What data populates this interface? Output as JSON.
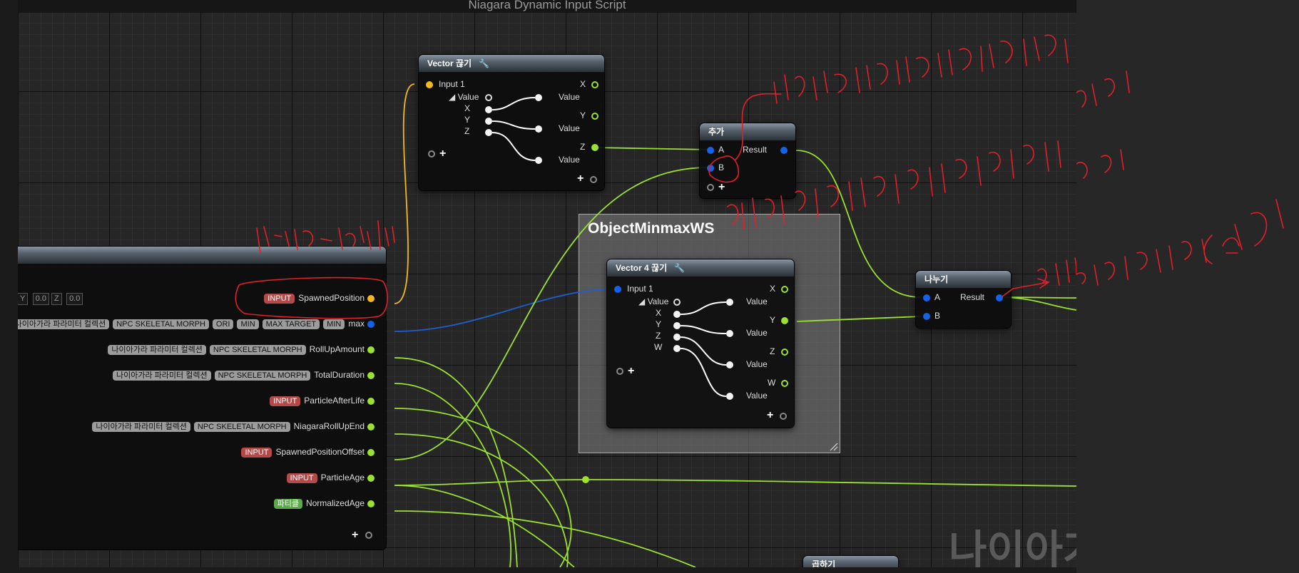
{
  "graph_title": "Niagara Dynamic Input Script",
  "watermark": "나이아가",
  "comment_title": "ObjectMinmaxWS",
  "colors": {
    "float_pin": "#9be130",
    "vector_pin": "#f2b823",
    "position_pin": "#1362e8",
    "annotation": "#e0202a"
  },
  "vec_break_node": {
    "title": "Vector 끊기",
    "input": "Input 1",
    "value": "Value",
    "subs": [
      "X",
      "Y",
      "Z"
    ],
    "outputs": [
      "X",
      "Y",
      "Z"
    ],
    "out_value": "Value"
  },
  "add_node": {
    "title": "추가",
    "a": "A",
    "b": "B",
    "result": "Result"
  },
  "vec4_break_node": {
    "title": "Vector 4 끊기",
    "input": "Input 1",
    "value": "Value",
    "subs": [
      "X",
      "Y",
      "Z",
      "W"
    ],
    "outputs": [
      "X",
      "Y",
      "Z",
      "W"
    ],
    "out_value": "Value"
  },
  "divide_node": {
    "title": "나누기",
    "a": "A",
    "b": "B",
    "result": "Result"
  },
  "multiply_node": {
    "title": "곱하기"
  },
  "map_node": {
    "vec_y_label": "Y",
    "vec_y": "0.0",
    "vec_z_label": "Z",
    "vec_z": "0.0",
    "rows": [
      {
        "tags": [
          {
            "t": "INPUT",
            "k": "input"
          }
        ],
        "name": "SpawnedPosition",
        "pin": "yellow"
      },
      {
        "tags": [
          {
            "t": "나이아가라 파라미터 컬렉션",
            "k": "gray"
          },
          {
            "t": "NPC SKELETAL MORPH",
            "k": "gray"
          },
          {
            "t": "ORI",
            "k": "gray"
          },
          {
            "t": "MIN",
            "k": "gray"
          },
          {
            "t": "MAX TARGET",
            "k": "gray"
          },
          {
            "t": "MIN",
            "k": "gray"
          }
        ],
        "name": "max",
        "pin": "blue"
      },
      {
        "tags": [
          {
            "t": "나이아가라 파라미터 컬렉션",
            "k": "gray"
          },
          {
            "t": "NPC SKELETAL MORPH",
            "k": "gray"
          }
        ],
        "name": "RollUpAmount",
        "pin": "green"
      },
      {
        "tags": [
          {
            "t": "나이아가라 파라미터 컬렉션",
            "k": "gray"
          },
          {
            "t": "NPC SKELETAL MORPH",
            "k": "gray"
          }
        ],
        "name": "TotalDuration",
        "pin": "green"
      },
      {
        "tags": [
          {
            "t": "INPUT",
            "k": "input"
          }
        ],
        "name": "ParticleAfterLife",
        "pin": "green"
      },
      {
        "tags": [
          {
            "t": "나이아가라 파라미터 컬렉션",
            "k": "gray"
          },
          {
            "t": "NPC SKELETAL MORPH",
            "k": "gray"
          }
        ],
        "name": "NiagaraRollUpEnd",
        "pin": "green"
      },
      {
        "tags": [
          {
            "t": "INPUT",
            "k": "input"
          }
        ],
        "name": "SpawnedPositionOffset",
        "pin": "green"
      },
      {
        "tags": [
          {
            "t": "INPUT",
            "k": "input"
          }
        ],
        "name": "ParticleAge",
        "pin": "green"
      },
      {
        "tags": [
          {
            "t": "파티클",
            "k": "green"
          }
        ],
        "name": "NormalizedAge",
        "pin": "green"
      }
    ]
  }
}
